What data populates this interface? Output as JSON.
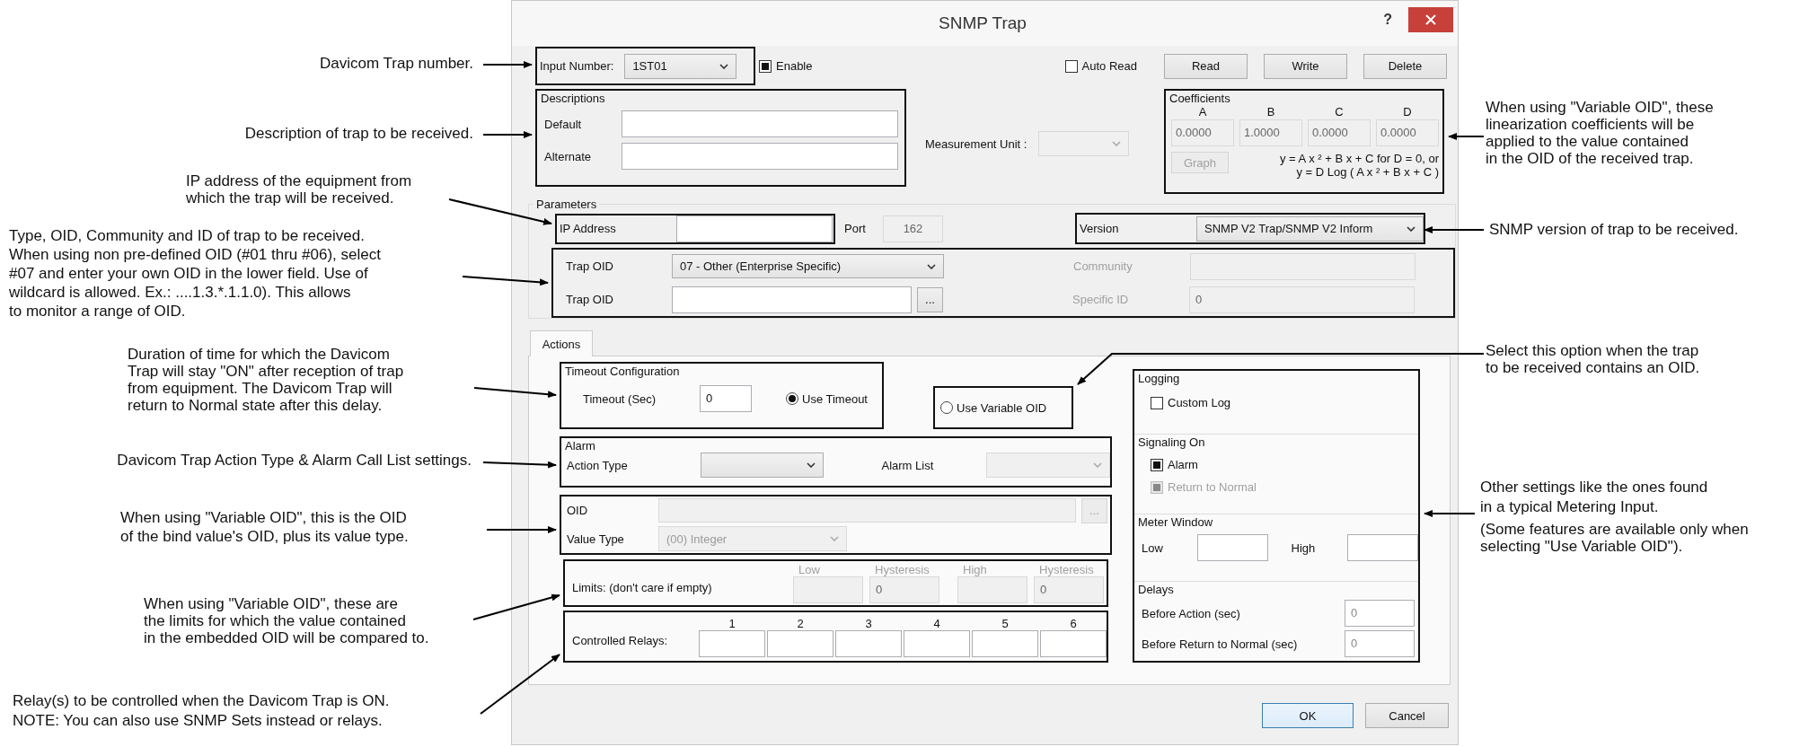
{
  "window": {
    "title": "SNMP Trap",
    "help": "?"
  },
  "input_number": {
    "label": "Input Number:",
    "value": "1ST01"
  },
  "enable": {
    "label": "Enable",
    "checked": true
  },
  "auto_read": {
    "label": "Auto Read",
    "checked": false
  },
  "top_buttons": [
    "Read",
    "Write",
    "Delete"
  ],
  "descriptions": {
    "title": "Descriptions",
    "fields": [
      {
        "label": "Default"
      },
      {
        "label": "Alternate"
      }
    ]
  },
  "measurement_unit": {
    "label": "Measurement Unit :",
    "disabled": true
  },
  "coefficients": {
    "title": "Coefficients",
    "disabled": true,
    "items": [
      {
        "label": "A",
        "value": "0.0000"
      },
      {
        "label": "B",
        "value": "1.0000"
      },
      {
        "label": "C",
        "value": "0.0000"
      },
      {
        "label": "D",
        "value": "0.0000"
      }
    ],
    "graph_button": "Graph",
    "formula": [
      "y = A x ² + B x + C for D = 0, or",
      "y = D Log ( A x ² + B x + C )"
    ]
  },
  "parameters": {
    "title": "Parameters",
    "ip_address": {
      "label": "IP Address"
    },
    "port": {
      "label": "Port",
      "value": "162",
      "disabled": true
    },
    "version": {
      "label": "Version",
      "value": "SNMP V2 Trap/SNMP V2 Inform"
    },
    "trap_oid_select": {
      "label": "Trap OID",
      "value": "07 - Other (Enterprise Specific)"
    },
    "trap_oid_field": {
      "label": "Trap OID",
      "button": "..."
    },
    "community": {
      "label": "Community",
      "disabled": true
    },
    "specific_id": {
      "label": "Specific ID",
      "value": "0",
      "disabled": true
    }
  },
  "tabs": [
    {
      "label": "Actions",
      "selected": true
    }
  ],
  "timeout": {
    "title": "Timeout Configuration",
    "label": "Timeout (Sec)",
    "value": "0"
  },
  "mode_options": [
    {
      "label": "Use Timeout",
      "selected": true
    },
    {
      "label": "Use Variable OID",
      "selected": false
    }
  ],
  "alarm": {
    "title": "Alarm",
    "action_type_label": "Action Type",
    "alarm_list_label": "Alarm List",
    "alarm_list_disabled": true
  },
  "oid": {
    "label": "OID",
    "button": "...",
    "disabled": true,
    "value_type_label": "Value Type",
    "value_type": "(00) Integer"
  },
  "limits": {
    "label": "Limits: (don't care if empty)",
    "disabled": true,
    "columns": [
      {
        "heading": "Low"
      },
      {
        "heading": "Hysteresis",
        "value": "0"
      },
      {
        "heading": "High"
      },
      {
        "heading": "Hysteresis",
        "value": "0"
      }
    ]
  },
  "relays": {
    "label": "Controlled Relays:",
    "numbers": [
      "1",
      "2",
      "3",
      "4",
      "5",
      "6"
    ]
  },
  "logging": {
    "title": "Logging",
    "custom_log": {
      "label": "Custom Log",
      "checked": false
    }
  },
  "signaling": {
    "title": "Signaling On",
    "options": [
      {
        "label": "Alarm",
        "checked": true,
        "disabled": false
      },
      {
        "label": "Return to Normal",
        "checked": true,
        "disabled": true
      }
    ]
  },
  "meter_window": {
    "title": "Meter Window",
    "low_label": "Low",
    "high_label": "High"
  },
  "delays": {
    "title": "Delays",
    "items": [
      {
        "label": "Before Action (sec)",
        "value": "0"
      },
      {
        "label": "Before Return to Normal (sec)",
        "value": "0"
      }
    ]
  },
  "dialog_buttons": [
    "OK",
    "Cancel"
  ],
  "callouts": [
    {
      "lines": [
        "Davicom Trap number."
      ]
    },
    {
      "lines": [
        "Description of trap to be received."
      ]
    },
    {
      "lines": [
        "IP address of the equipment from",
        "which the trap will be received."
      ]
    },
    {
      "lines": [
        "Type, OID, Community and ID of trap to be received.",
        "When using non pre-defined OID (#01 thru #06), select",
        "#07 and enter your own OID in the lower field. Use of",
        "wildcard is allowed. Ex.: ....1.3.*.1.1.0). This allows",
        "to monitor a range of OID."
      ]
    },
    {
      "lines": [
        "Duration of time for which the Davicom",
        "Trap will stay \"ON\" after reception of trap",
        "from equipment. The Davicom Trap will",
        "return to Normal state after this delay."
      ]
    },
    {
      "lines": [
        "Davicom Trap Action Type & Alarm Call List settings."
      ]
    },
    {
      "lines": [
        "When using \"Variable OID\", this is the OID",
        "of the bind value's OID, plus its value type."
      ]
    },
    {
      "lines": [
        "When using \"Variable OID\", these are",
        "the limits for which the value contained",
        "in the embedded OID will be compared to."
      ]
    },
    {
      "lines": [
        "Relay(s) to be controlled when the Davicom Trap is ON.",
        "NOTE: You can also use SNMP Sets instead or relays."
      ]
    },
    {
      "lines": [
        "When using \"Variable OID\", these",
        "linearization coefficients will be",
        "applied to the value contained",
        "in the OID of the received trap."
      ]
    },
    {
      "lines": [
        "SNMP version of trap to be received."
      ]
    },
    {
      "lines": [
        "Select this option when the trap",
        "to be received contains an OID."
      ]
    },
    {
      "lines": [
        "Other settings like the ones found",
        "in a typical Metering Input."
      ],
      "note": [
        "(Some features are available only when",
        "selecting \"Use Variable OID\")."
      ]
    }
  ]
}
